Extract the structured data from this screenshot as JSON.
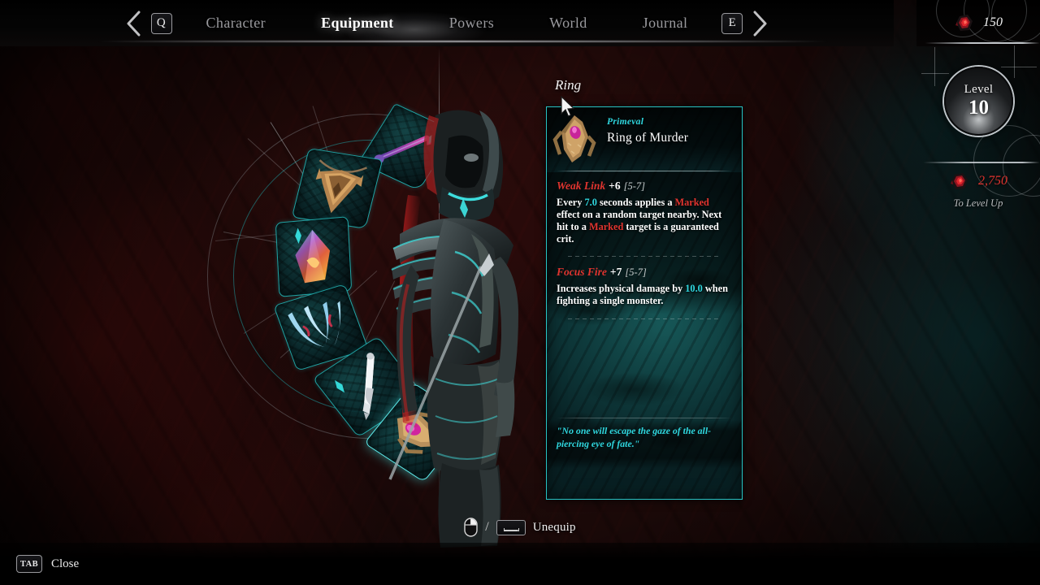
{
  "nav": {
    "prev_key": "Q",
    "next_key": "E",
    "prev_icon": "chevron-left-icon",
    "next_icon": "chevron-right-icon",
    "tabs": [
      {
        "label": "Character",
        "active": false
      },
      {
        "label": "Equipment",
        "active": true
      },
      {
        "label": "Powers",
        "active": false
      },
      {
        "label": "World",
        "active": false
      },
      {
        "label": "Journal",
        "active": false
      }
    ]
  },
  "slot_label": "Ring",
  "tooltip": {
    "rarity": "Primeval",
    "name": "Ring of Murder",
    "icon": "ring-item-icon",
    "affixes": [
      {
        "name": "Weak Link",
        "value": "+6",
        "range": "[5-7]",
        "desc_parts": [
          {
            "text": "Every ",
            "style": "plain"
          },
          {
            "text": "7.0",
            "style": "number"
          },
          {
            "text": " seconds applies a ",
            "style": "plain"
          },
          {
            "text": "Marked",
            "style": "keyword"
          },
          {
            "text": " effect on a random target nearby. Next hit to a ",
            "style": "plain"
          },
          {
            "text": "Marked",
            "style": "keyword"
          },
          {
            "text": " target is a guaranteed crit.",
            "style": "plain"
          }
        ]
      },
      {
        "name": "Focus Fire",
        "value": "+7",
        "range": "[5-7]",
        "desc_parts": [
          {
            "text": "Increases physical damage by ",
            "style": "plain"
          },
          {
            "text": "10.0",
            "style": "number"
          },
          {
            "text": " when fighting a single monster.",
            "style": "plain"
          }
        ]
      }
    ],
    "flavor": "\"No one will escape the gaze of the all-piercing eye of fate.\""
  },
  "equipment_slots": [
    {
      "name": "slot-weapon-top",
      "icon": "purple-wand-icon",
      "selected": false
    },
    {
      "name": "slot-amulet",
      "icon": "bronze-amulet-icon",
      "selected": false
    },
    {
      "name": "slot-gem",
      "icon": "fire-crystal-icon",
      "selected": false
    },
    {
      "name": "slot-gloves",
      "icon": "blue-claws-icon",
      "selected": false
    },
    {
      "name": "slot-sword",
      "icon": "silver-sword-icon",
      "selected": false
    },
    {
      "name": "slot-ring",
      "icon": "ring-item-icon",
      "selected": true
    }
  ],
  "stats_panel": {
    "currency_value": "150",
    "currency_icon": "red-ore-icon",
    "level_label": "Level",
    "level_value": "10",
    "xp_value": "2,750",
    "xp_icon": "red-ore-icon",
    "xp_caption": "To Level Up"
  },
  "footer": {
    "action_mouse_icon": "mouse-right-click-icon",
    "action_separator": "/",
    "action_key_icon": "spacebar-key-icon",
    "action_label": "Unequip",
    "close_key": "TAB",
    "close_label": "Close"
  },
  "colors": {
    "accent_cyan": "#2fd8e0",
    "accent_red": "#e0342f",
    "slot_border": "#28cdcd",
    "panel_teal": "#165c5c"
  }
}
